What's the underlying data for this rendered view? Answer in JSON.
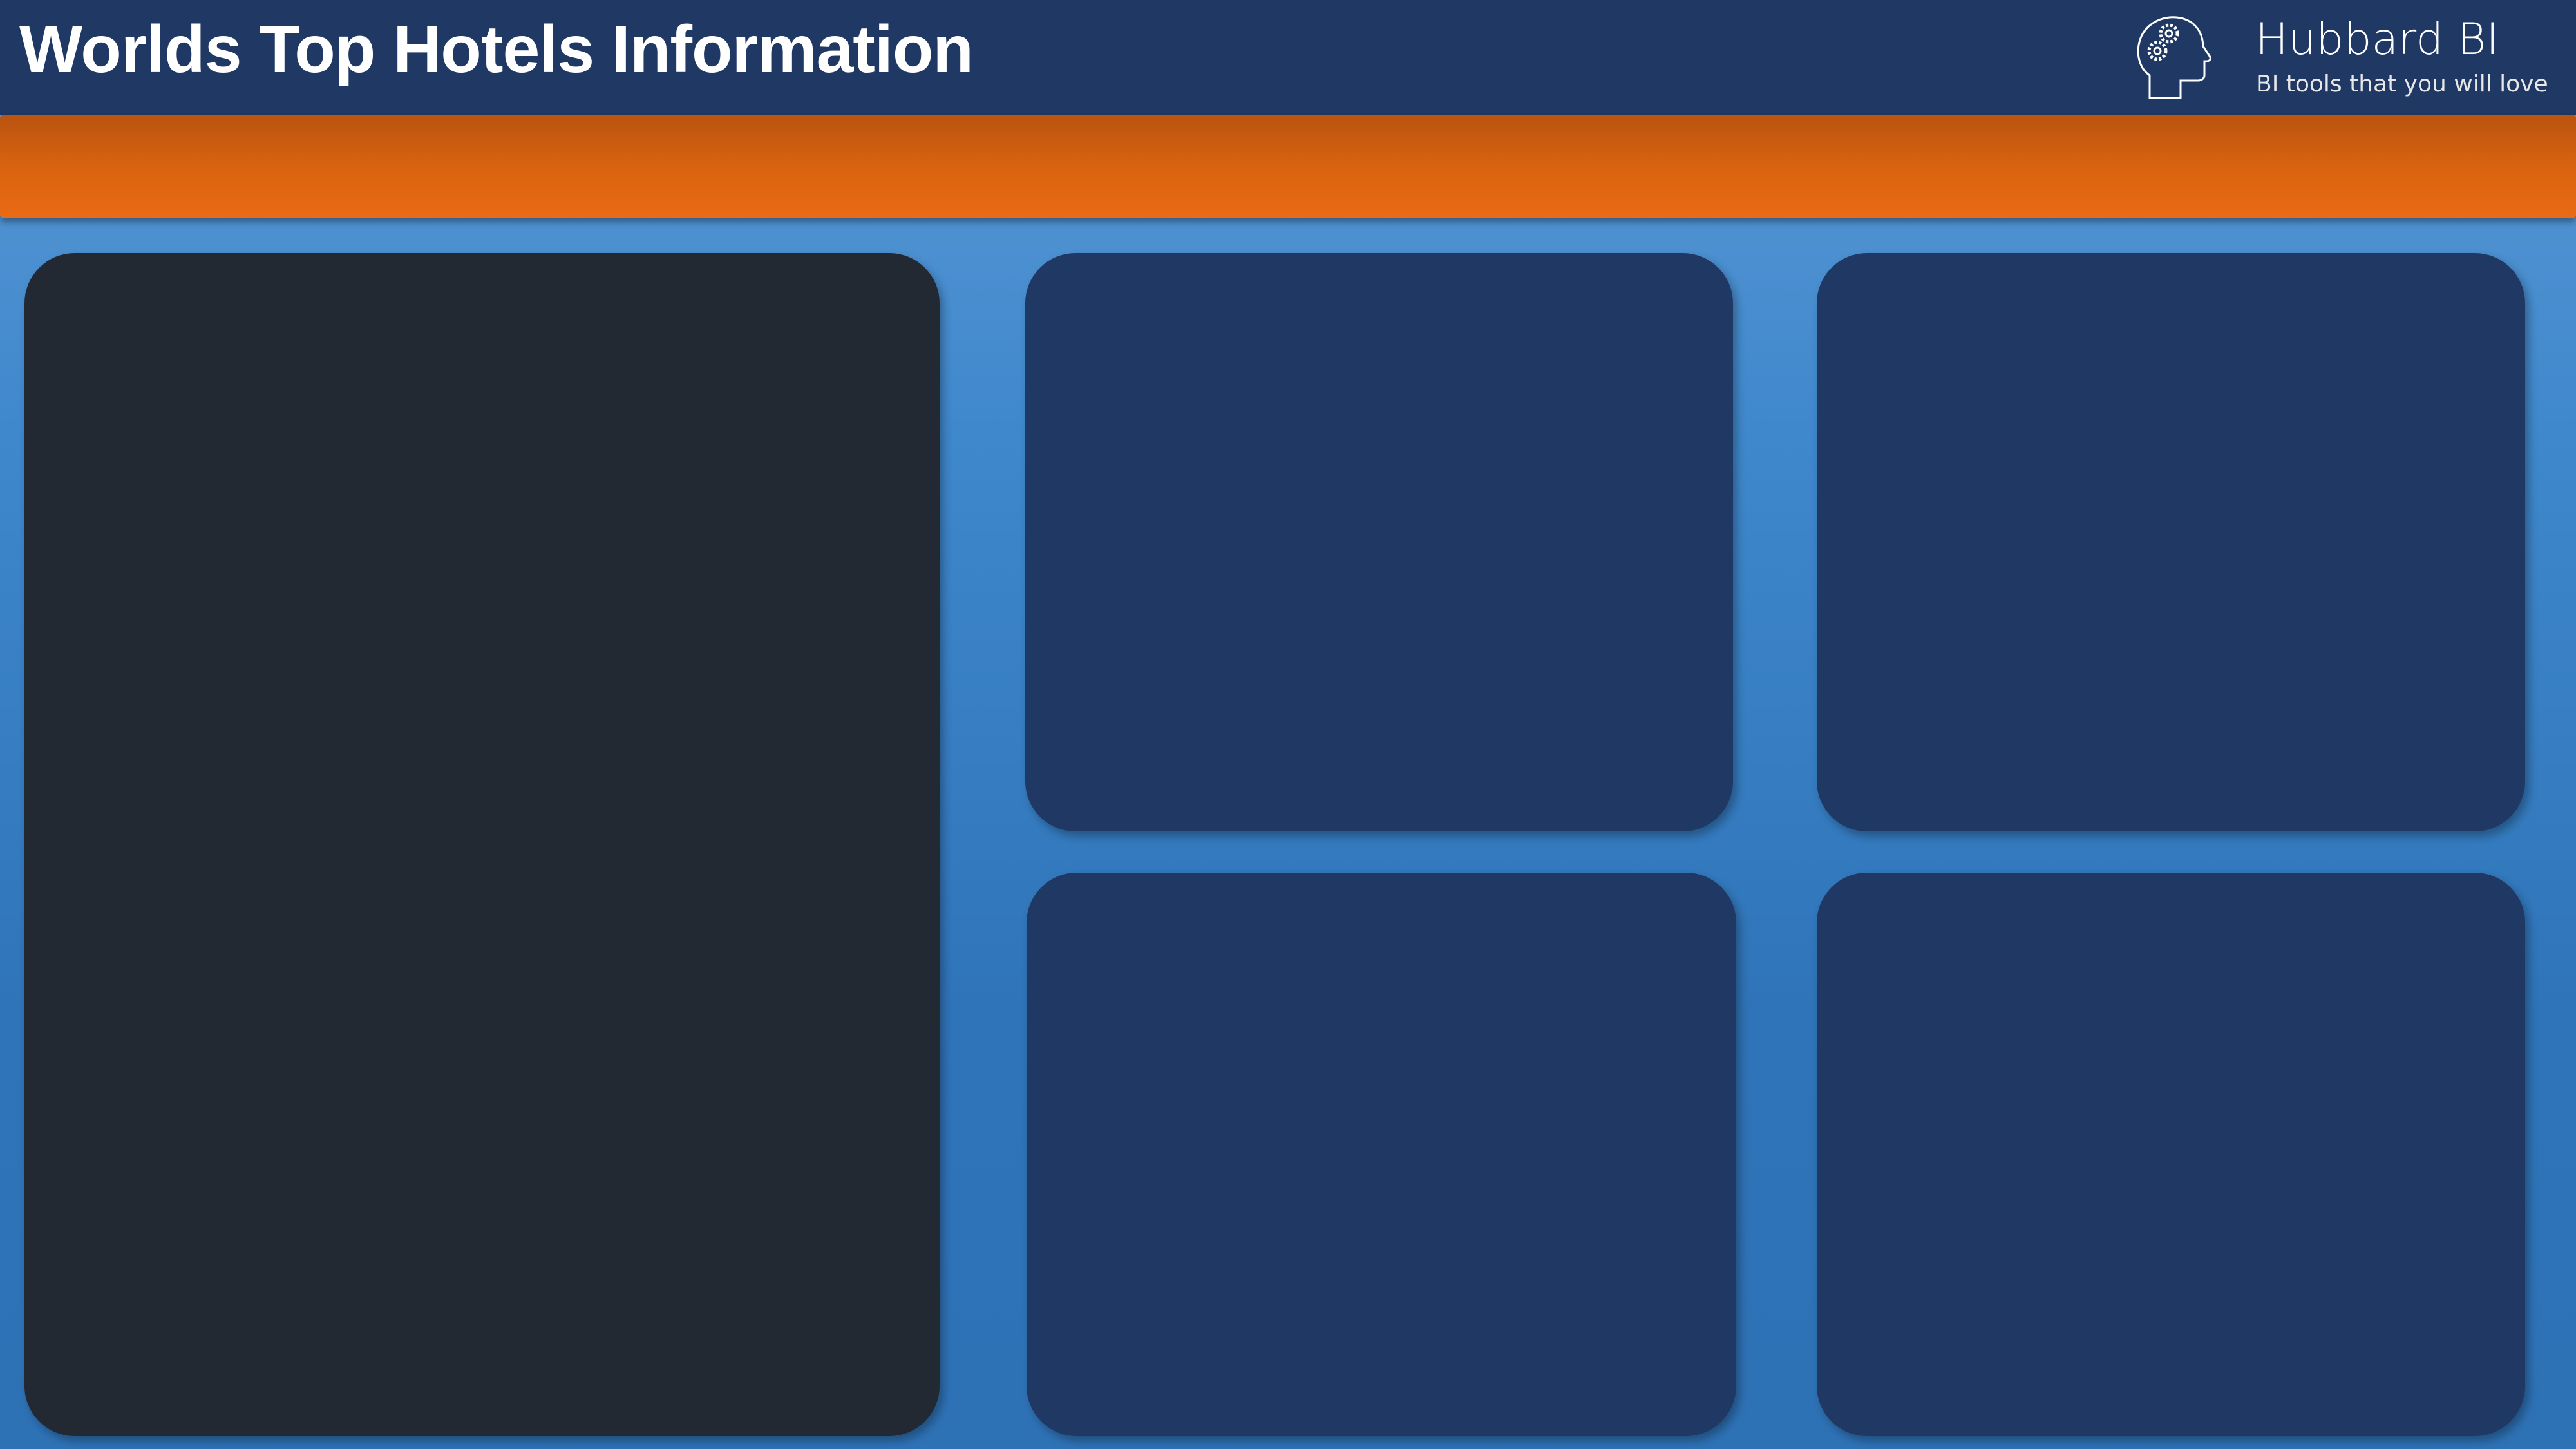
{
  "header": {
    "title": "Worlds Top Hotels Information",
    "brand_name": "Hubbard BI",
    "brand_tagline": "BI tools that you will love",
    "logo_icon": "head-with-gears-icon"
  },
  "colors": {
    "header_bg": "#203864",
    "accent_bar": "#e8681a",
    "panel": "#203864",
    "panel_dark": "#222933",
    "background": "#3f88cc"
  }
}
